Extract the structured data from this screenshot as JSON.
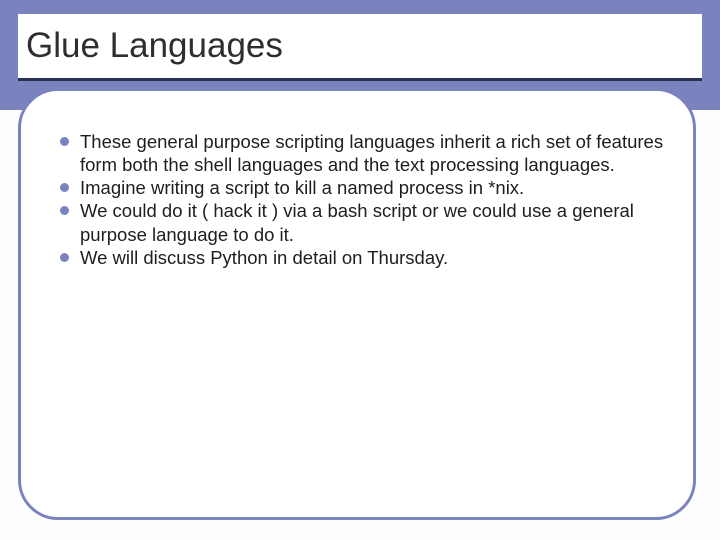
{
  "title": "Glue Languages",
  "bullets": [
    "These general purpose scripting languages inherit a rich set of features form both the shell languages and the text processing languages.",
    "Imagine writing a script to kill a named process in *nix.",
    "We could do it ( hack it ) via a bash script or we could use a general purpose language to do it.",
    "We will discuss Python in detail on Thursday."
  ]
}
